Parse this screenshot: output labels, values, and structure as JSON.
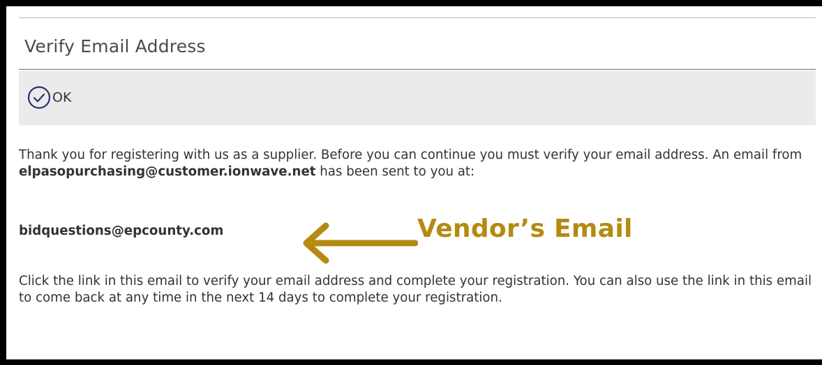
{
  "dialog": {
    "title": "Verify Email Address"
  },
  "toolbar": {
    "ok_label": "OK",
    "ok_icon": "check-circle-icon"
  },
  "message": {
    "intro_before": "Thank you for registering with us as a supplier. Before you can continue you must verify your email address. An email from ",
    "sender_email": "elpasopurchasing@customer.ionwave.net",
    "intro_after": " has been sent to you at:",
    "recipient_email": "bidquestions@epcounty.com",
    "instructions": "Click the link in this email to verify your email address and complete your registration. You can also use the link in this email to come back at any time in the next 14 days to complete your registration."
  },
  "annotation": {
    "label": "Vendor’s Email",
    "color": "#b58a12",
    "arrow_icon": "left-arrow-icon"
  },
  "colors": {
    "toolbar_bg": "#ebebeb",
    "icon_accent": "#2b2f6b",
    "frame": "#000000"
  }
}
